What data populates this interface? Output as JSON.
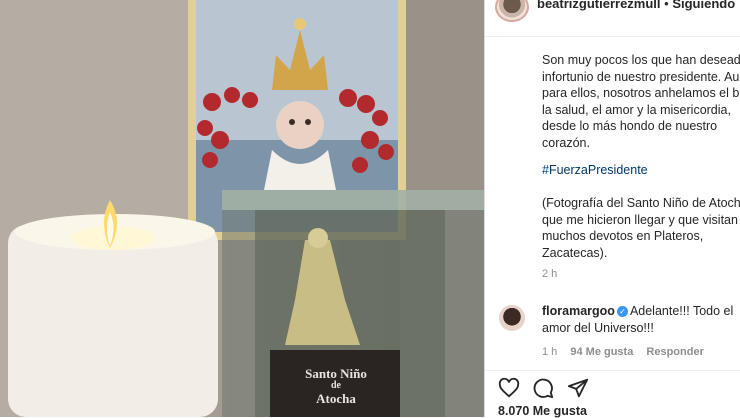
{
  "post": {
    "image_alt": "Vela y Santo Niño de Atocha",
    "plaque_line1": "Santo Niño",
    "plaque_line2": "de",
    "plaque_line3": "Atocha"
  },
  "header": {
    "username": "beatrizgutierrezmull",
    "separator": " • ",
    "follow_status": "Siguiendo"
  },
  "caption": {
    "lines": [
      "Son muy pocos los que han deseado el",
      "infortunio de nuestro presidente. Aun",
      "para ellos, nosotros anhelamos el bien,",
      "la salud, el amor y la misericordia,",
      "desde lo más hondo de nuestro",
      "corazón."
    ],
    "hashtag": "#FuerzaPresidente",
    "note_lines": [
      "(Fotografía del Santo Niño de Atocha",
      "que me hicieron llegar y que visitan",
      "muchos devotos en Plateros,",
      "Zacatecas)."
    ],
    "time": "2 h"
  },
  "comment": {
    "username": "floramargoo",
    "text_line1": "Adelante!!! Todo el",
    "text_line2": "amor del Universo!!!",
    "time": "1 h",
    "likes": "94 Me gusta",
    "reply": "Responder"
  },
  "actions": {
    "icons": [
      "heart-icon",
      "comment-icon",
      "share-icon"
    ],
    "likes": "8.070 Me gusta"
  },
  "colors": {
    "link": "#00376b",
    "verified": "#3897f0",
    "text": "#262626",
    "meta": "#8e8e8e"
  }
}
